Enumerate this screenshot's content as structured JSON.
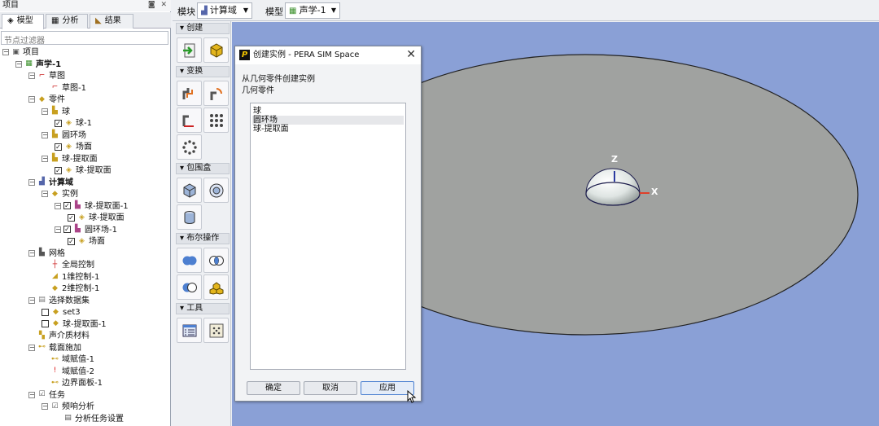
{
  "panel": {
    "title": "项目",
    "buttons": "◙ ✕"
  },
  "tabs": [
    {
      "label": "模型",
      "icon": "cube-icon"
    },
    {
      "label": "分析",
      "icon": "table-icon"
    },
    {
      "label": "结果",
      "icon": "chart-icon"
    }
  ],
  "filter": {
    "placeholder": "节点过滤器"
  },
  "tree": [
    {
      "label": "项目",
      "level": 0,
      "exp": "−",
      "icon": "project-icon",
      "glyph": "▣",
      "color": "#555"
    },
    {
      "label": "声学-1",
      "level": 1,
      "exp": "−",
      "icon": "acoustic-model-icon",
      "glyph": "▦",
      "color": "#3a8f2a",
      "bold": true
    },
    {
      "label": "草图",
      "level": 2,
      "exp": "−",
      "icon": "sketch-icon",
      "glyph": "⌐",
      "color": "#cc2222"
    },
    {
      "label": "草图-1",
      "level": 3,
      "icon": "sketch-icon",
      "glyph": "⌐",
      "color": "#cc2222"
    },
    {
      "label": "零件",
      "level": 2,
      "exp": "−",
      "icon": "parts-icon",
      "glyph": "◆",
      "color": "#c8a020"
    },
    {
      "label": "球",
      "level": 3,
      "exp": "−",
      "icon": "part-icon",
      "glyph": "▙",
      "color": "#c8a020"
    },
    {
      "label": "球-1",
      "level": 4,
      "check": true,
      "icon": "body-icon",
      "glyph": "◈",
      "color": "#c8a020"
    },
    {
      "label": "圆环场",
      "level": 3,
      "exp": "−",
      "icon": "part-icon",
      "glyph": "▙",
      "color": "#c8a020"
    },
    {
      "label": "场面",
      "level": 4,
      "check": true,
      "icon": "body-icon",
      "glyph": "◈",
      "color": "#c8a020"
    },
    {
      "label": "球-提取面",
      "level": 3,
      "exp": "−",
      "icon": "part-icon",
      "glyph": "▙",
      "color": "#c8a020"
    },
    {
      "label": "球-提取面",
      "level": 4,
      "check": true,
      "icon": "body-icon",
      "glyph": "◈",
      "color": "#c8a020"
    },
    {
      "label": "计算域",
      "level": 2,
      "exp": "−",
      "icon": "domain-icon",
      "glyph": "▟",
      "color": "#5566aa",
      "bold": true
    },
    {
      "label": "实例",
      "level": 3,
      "exp": "−",
      "icon": "instance-icon",
      "glyph": "◆",
      "color": "#c8a020"
    },
    {
      "label": "球-提取面-1",
      "level": 4,
      "exp": "−",
      "check": true,
      "icon": "instance-icon",
      "glyph": "▙",
      "color": "#aa4488"
    },
    {
      "label": "球-提取面",
      "level": 5,
      "check": true,
      "icon": "body-icon",
      "glyph": "◈",
      "color": "#c8a020"
    },
    {
      "label": "圆环场-1",
      "level": 4,
      "exp": "−",
      "check": true,
      "icon": "instance-icon",
      "glyph": "▙",
      "color": "#aa4488"
    },
    {
      "label": "场面",
      "level": 5,
      "check": true,
      "icon": "body-icon",
      "glyph": "◈",
      "color": "#c8a020"
    },
    {
      "label": "网格",
      "level": 2,
      "exp": "−",
      "icon": "mesh-icon",
      "glyph": "▙",
      "color": "#555"
    },
    {
      "label": "全局控制",
      "level": 3,
      "icon": "global-control-icon",
      "glyph": "┼",
      "color": "#cc2222"
    },
    {
      "label": "1维控制-1",
      "level": 3,
      "icon": "1d-control-icon",
      "glyph": "◢",
      "color": "#c8a020"
    },
    {
      "label": "2维控制-1",
      "level": 3,
      "icon": "2d-control-icon",
      "glyph": "◆",
      "color": "#c8a020"
    },
    {
      "label": "选择数据集",
      "level": 2,
      "exp": "−",
      "icon": "dataset-icon",
      "glyph": "▤",
      "color": "#777"
    },
    {
      "label": "set3",
      "level": 3,
      "check": false,
      "icon": "set-icon",
      "glyph": "◆",
      "color": "#c8a020"
    },
    {
      "label": "球-提取面-1",
      "level": 3,
      "check": false,
      "icon": "set-icon",
      "glyph": "◆",
      "color": "#c8a020"
    },
    {
      "label": "声介质材料",
      "level": 2,
      "icon": "material-icon",
      "glyph": "▚",
      "color": "#c8a020"
    },
    {
      "label": "载面施加",
      "level": 2,
      "exp": "−",
      "icon": "load-icon",
      "glyph": "⊷",
      "color": "#c8a020"
    },
    {
      "label": "域赋值-1",
      "level": 3,
      "icon": "domain-assign-icon",
      "glyph": "⊷",
      "color": "#c8a020"
    },
    {
      "label": "域赋值-2",
      "level": 3,
      "icon": "warning-icon",
      "glyph": "!",
      "color": "#dd1111"
    },
    {
      "label": "边界面板-1",
      "level": 3,
      "icon": "boundary-icon",
      "glyph": "⊷",
      "color": "#c8a020"
    },
    {
      "label": "任务",
      "level": 2,
      "exp": "−",
      "icon": "task-icon",
      "glyph": "☑",
      "color": "#555"
    },
    {
      "label": "频响分析",
      "level": 3,
      "exp": "−",
      "icon": "analysis-icon",
      "glyph": "☑",
      "color": "#555"
    },
    {
      "label": "分析任务设置",
      "level": 4,
      "icon": "settings-icon",
      "glyph": "▤",
      "color": "#555"
    }
  ],
  "topbar": {
    "module_label": "模块",
    "module_value": "计算域",
    "model_label": "模型",
    "model_value": "声学-1"
  },
  "toolbox": {
    "sections": [
      "创建",
      "变换",
      "包围盒",
      "布尔操作",
      "工具"
    ]
  },
  "dialog": {
    "title": "创建实例 - PERA SIM Space",
    "logo": "P",
    "instruction": "从几何零件创建实例",
    "list_label": "几何零件",
    "items": [
      "球",
      "圆环场",
      "球-提取面"
    ],
    "selected_index": 1,
    "buttons": {
      "ok": "确定",
      "cancel": "取消",
      "apply": "应用"
    }
  },
  "viewport": {
    "axis_z": "Z",
    "axis_x": "X",
    "background": "#8aa0d6",
    "disk_color": "#a0a2a0"
  }
}
